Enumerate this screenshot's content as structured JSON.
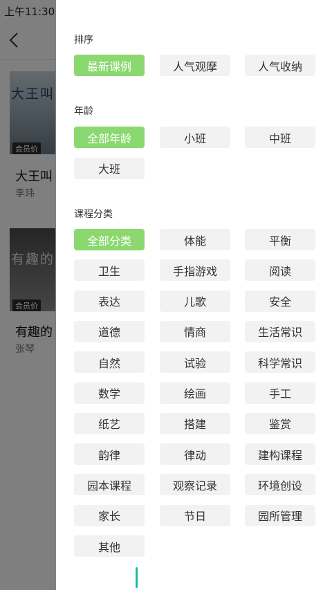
{
  "status_bar": {
    "time": "上午11:30"
  },
  "background": {
    "courses": [
      {
        "thumb_title": "大王叫",
        "badge": "会员价",
        "title": "大王叫",
        "author": "李玮"
      },
      {
        "thumb_title": "有趣的",
        "badge": "会员价",
        "title": "有趣的",
        "author": "张琴"
      }
    ]
  },
  "filter": {
    "sort": {
      "title": "排序",
      "options": [
        "最新课例",
        "人气观摩",
        "人气收纳"
      ],
      "selected": "最新课例"
    },
    "age": {
      "title": "年龄",
      "options": [
        "全部年龄",
        "小班",
        "中班",
        "大班"
      ],
      "selected": "全部年龄"
    },
    "category": {
      "title": "课程分类",
      "options": [
        "全部分类",
        "体能",
        "平衡",
        "卫生",
        "手指游戏",
        "阅读",
        "表达",
        "儿歌",
        "安全",
        "道德",
        "情商",
        "生活常识",
        "自然",
        "试验",
        "科学常识",
        "数学",
        "绘画",
        "手工",
        "纸艺",
        "搭建",
        "鉴赏",
        "韵律",
        "律动",
        "建构课程",
        "园本课程",
        "观察记录",
        "环境创设",
        "家长",
        "节日",
        "园所管理",
        "其他"
      ],
      "selected": "全部分类"
    }
  },
  "colors": {
    "accent": "#8ad86f",
    "chip_bg": "#f2f2f2"
  }
}
